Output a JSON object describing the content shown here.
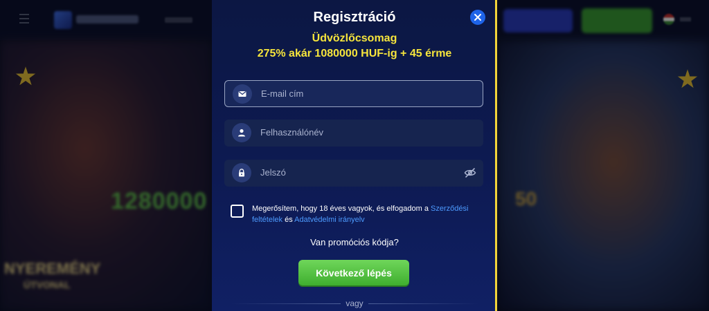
{
  "background": {
    "logo_text": "AZURSLOT",
    "bg_amount": "1280000",
    "bg_badge_line1": "NYEREMÉNY",
    "bg_badge_line2": "ÚTVONAL",
    "bg_fifty": "50"
  },
  "modal": {
    "title": "Regisztráció",
    "promo_line1": "Üdvözlőcsomag",
    "promo_line2": "275% akár 1080000 HUF-ig + 45 érme",
    "email_placeholder": "E-mail cím",
    "username_placeholder": "Felhasználónév",
    "password_placeholder": "Jelszó",
    "terms_prefix": "Megerősítem, hogy 18 éves vagyok, és elfogadom a ",
    "terms_link": "Szerződési feltételek",
    "terms_middle": " és ",
    "privacy_link": "Adatvédelmi irányelv",
    "promo_code_text": "Van promóciós kódja?",
    "next_button": "Következő lépés",
    "or_text": "vagy"
  },
  "colors": {
    "accent_yellow": "#f6e53c",
    "link_blue": "#4d9bff",
    "button_green": "#3fae2f",
    "close_blue": "#1e63e8"
  },
  "icons": {
    "close": "close-icon",
    "email": "mail-icon",
    "username": "user-icon",
    "password": "lock-icon",
    "visibility": "eye-off-icon"
  }
}
